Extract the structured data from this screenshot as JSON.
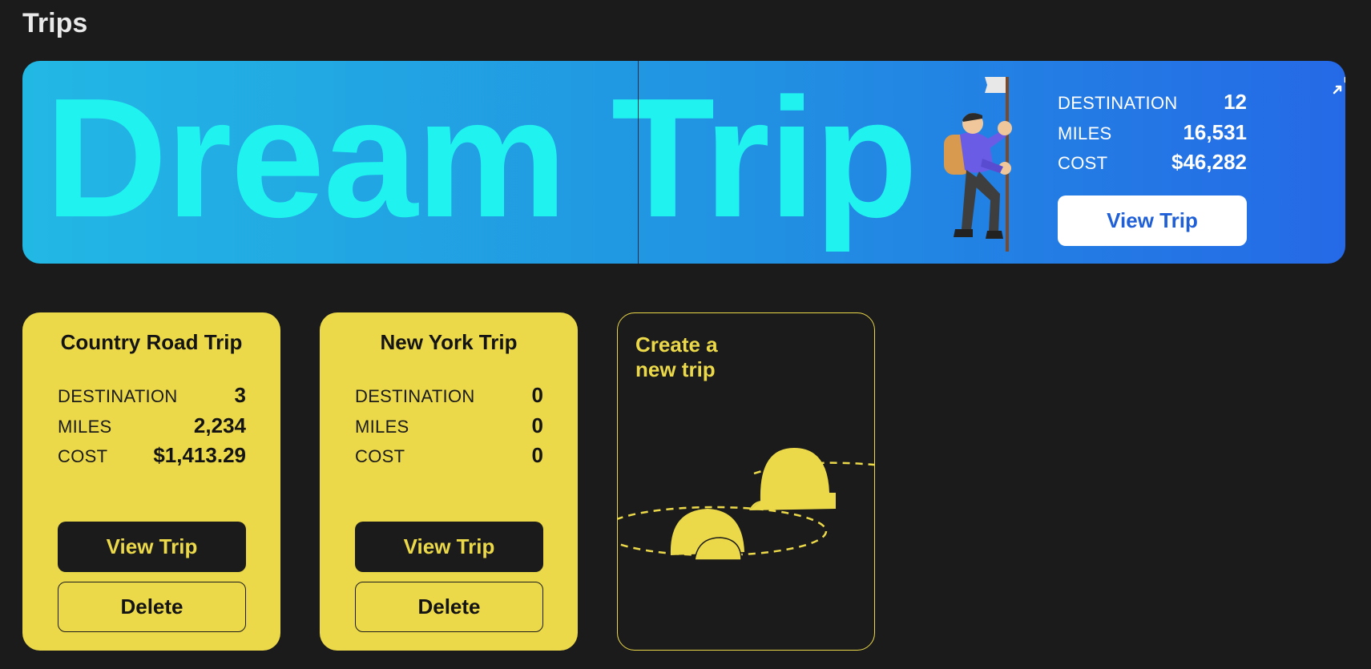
{
  "page": {
    "title": "Trips"
  },
  "hero": {
    "title": "Dream Trip",
    "stats": [
      {
        "label": "DESTINATION",
        "value": "12"
      },
      {
        "label": "MILES",
        "value": "16,531"
      },
      {
        "label": "COST",
        "value": "$46,282"
      }
    ],
    "view_label": "View Trip",
    "collapse_icon": "collapse-arrows-icon",
    "colors": {
      "gradient_start": "#22b8e4",
      "gradient_end": "#2569e6",
      "title": "#20f2f0"
    }
  },
  "cards": [
    {
      "title": "Country Road Trip",
      "stats": [
        {
          "label": "DESTINATION",
          "value": "3"
        },
        {
          "label": "MILES",
          "value": "2,234"
        },
        {
          "label": "COST",
          "value": "$1,413.29"
        }
      ],
      "view_label": "View Trip",
      "delete_label": "Delete"
    },
    {
      "title": "New York Trip",
      "stats": [
        {
          "label": "DESTINATION",
          "value": "0"
        },
        {
          "label": "MILES",
          "value": "0"
        },
        {
          "label": "COST",
          "value": "0"
        }
      ],
      "view_label": "View Trip",
      "delete_label": "Delete"
    }
  ],
  "create": {
    "label": "Create a new trip",
    "icon": "tent-camp-icon"
  },
  "colors": {
    "background": "#1b1b1b",
    "card": "#ecd94a",
    "accent_blue": "#1f5fd8"
  }
}
